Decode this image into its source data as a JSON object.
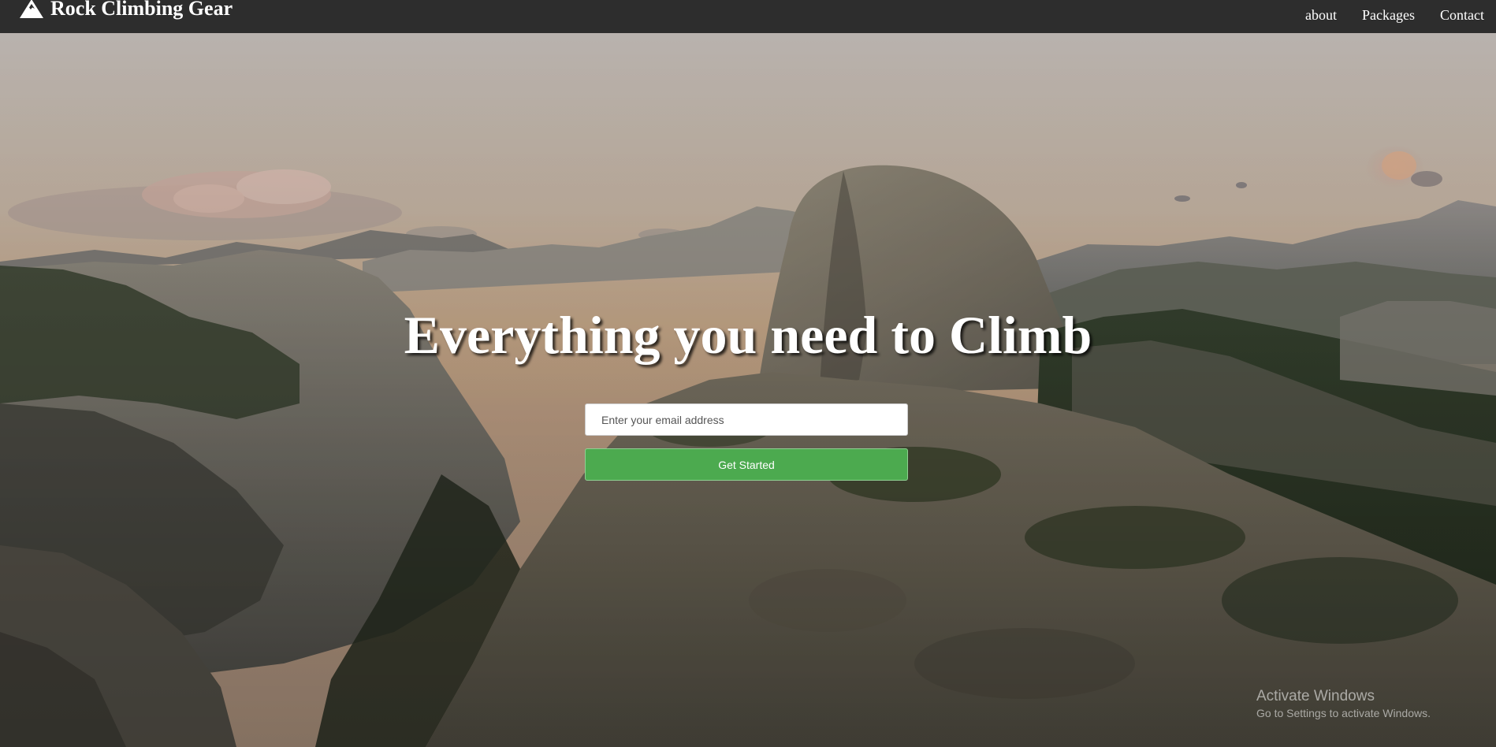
{
  "navbar": {
    "brand_icon": "mountain-icon",
    "brand_name": "Rock Climbing Gear",
    "links": [
      {
        "label": "about"
      },
      {
        "label": "Packages"
      },
      {
        "label": "Contact"
      }
    ]
  },
  "hero": {
    "background_image": "mountain-valley-photo",
    "headline": "Everything you need to Climb",
    "email_placeholder": "Enter your email address",
    "email_value": "",
    "cta_label": "Get Started"
  },
  "watermark": {
    "title": "Activate Windows",
    "subtitle": "Go to Settings to activate Windows."
  },
  "colors": {
    "navbar_bg": "#2d2d2d",
    "cta_green": "#4caa4f",
    "text_white": "#ffffff"
  }
}
